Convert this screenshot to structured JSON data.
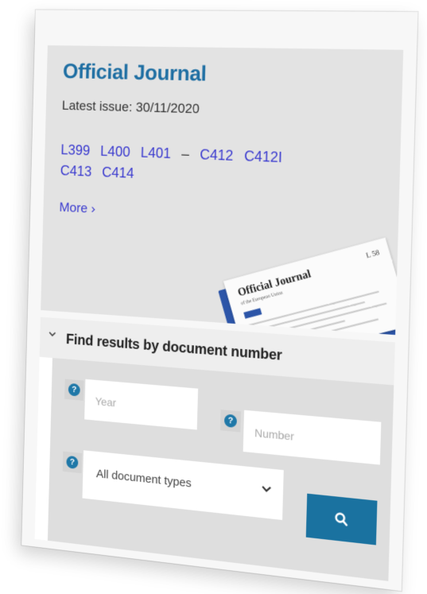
{
  "official_journal": {
    "title": "Official Journal",
    "latest_issue": "Latest issue: 30/11/2020",
    "issues_l": [
      "L399",
      "L400",
      "L401"
    ],
    "separator": "–",
    "issues_c_line1": [
      "C412",
      "C412I"
    ],
    "issues_c_line2": [
      "C413",
      "C414"
    ],
    "more_label": "More ›"
  },
  "journal_image": {
    "title": "Official Journal",
    "subtitle": "of the European Union",
    "number": "L 58"
  },
  "find": {
    "title": "Find results by document number",
    "year_placeholder": "Year",
    "number_placeholder": "Number",
    "doc_type_selected": "All document types",
    "help_glyph": "?"
  },
  "colors": {
    "title_blue": "#1f6fa3",
    "link_blue": "#3a3acf",
    "button_blue": "#1a72a0"
  },
  "icons": {
    "collapse": "chevron-down-icon",
    "help": "help-icon",
    "dropdown": "chevron-down-icon",
    "search": "search-icon"
  }
}
